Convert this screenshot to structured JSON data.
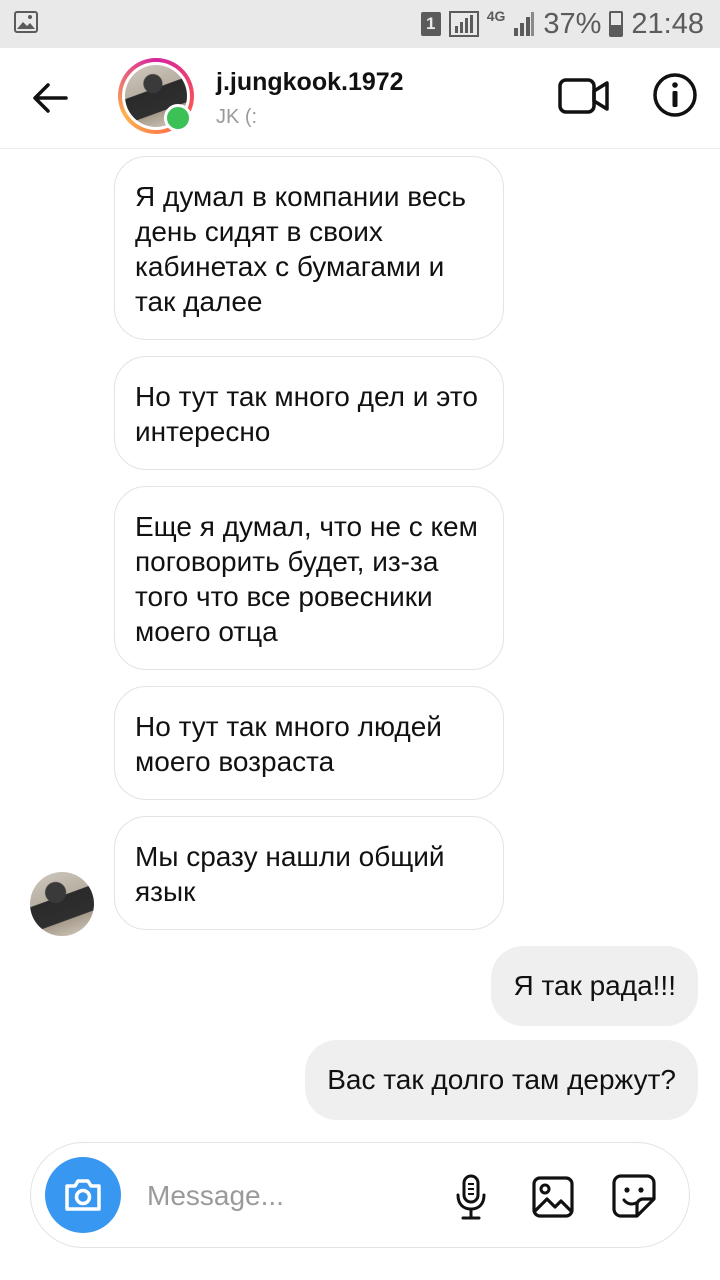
{
  "status_bar": {
    "sim_slot": "1",
    "network": "4G",
    "battery": "37%",
    "time": "21:48"
  },
  "header": {
    "username": "j.jungkook.1972",
    "subtitle": "JK (:",
    "online_color": "#3cc157"
  },
  "messages": [
    {
      "direction": "incoming",
      "text": "Я думал в компании весь день сидят в своих кабинетах с бумагами и так далее"
    },
    {
      "direction": "incoming",
      "text": "Но тут так много дел и это интересно"
    },
    {
      "direction": "incoming",
      "text": "Еще я думал, что не с кем поговорить будет, из-за того что все ровесники моего отца"
    },
    {
      "direction": "incoming",
      "text": "Но тут так много людей моего возраста"
    },
    {
      "direction": "incoming",
      "text": "Мы сразу нашли общий язык"
    },
    {
      "direction": "outgoing",
      "text": "Я так рада!!!"
    },
    {
      "direction": "outgoing",
      "text": "Вас так долго там держут?"
    }
  ],
  "composer": {
    "placeholder": "Message...",
    "accent": "#3897f0"
  },
  "icons": [
    "gallery-icon",
    "back-arrow-icon",
    "video-call-icon",
    "info-icon",
    "camera-icon",
    "microphone-icon",
    "image-icon",
    "sticker-icon"
  ]
}
